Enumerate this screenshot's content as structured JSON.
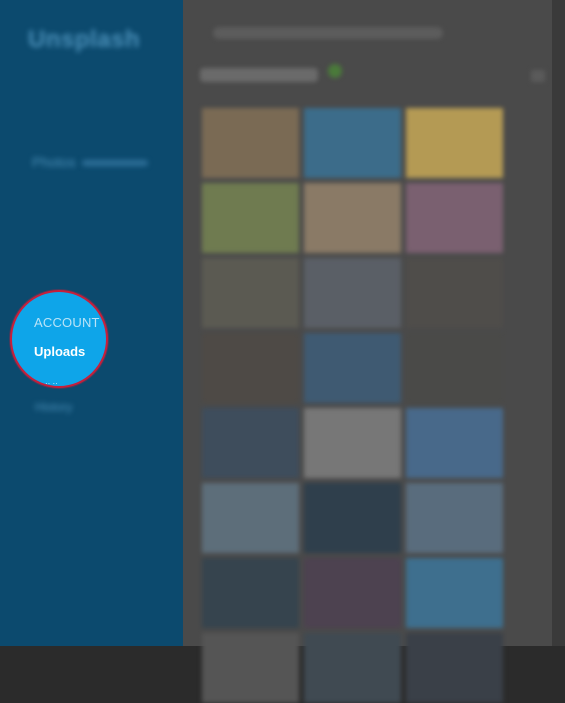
{
  "sidebar": {
    "brand": "Unsplash",
    "section_heading": "Photos",
    "focus_items": {
      "account": "ACCOUNT",
      "uploads": "Uploads",
      "peek": "·· ·· "
    },
    "nav_after": "History"
  },
  "main": {
    "title": "Featured Photos",
    "tiles": [
      {
        "color": "#7a6a54"
      },
      {
        "color": "#3c6c8a"
      },
      {
        "color": "#b49a54"
      },
      {
        "color": "#6f7b50"
      },
      {
        "color": "#8a7a66"
      },
      {
        "color": "#7a6070"
      },
      {
        "color": "#5b5a52"
      },
      {
        "color": "#5a5f66"
      },
      {
        "color": "#4f4d4a"
      },
      {
        "color": "#4e4a46"
      },
      {
        "color": "#3f5a72"
      },
      {
        "color": "#4a4a48"
      },
      {
        "color": "#3e4d5c"
      },
      {
        "color": "#777777"
      },
      {
        "color": "#48698a"
      },
      {
        "color": "#5d6e7a"
      },
      {
        "color": "#2f3f4c"
      },
      {
        "color": "#596c7d"
      },
      {
        "color": "#36444e"
      },
      {
        "color": "#4d4250"
      },
      {
        "color": "#3e6f8e"
      },
      {
        "color": "#555555"
      },
      {
        "color": "#404a52"
      },
      {
        "color": "#3a4048"
      }
    ]
  }
}
